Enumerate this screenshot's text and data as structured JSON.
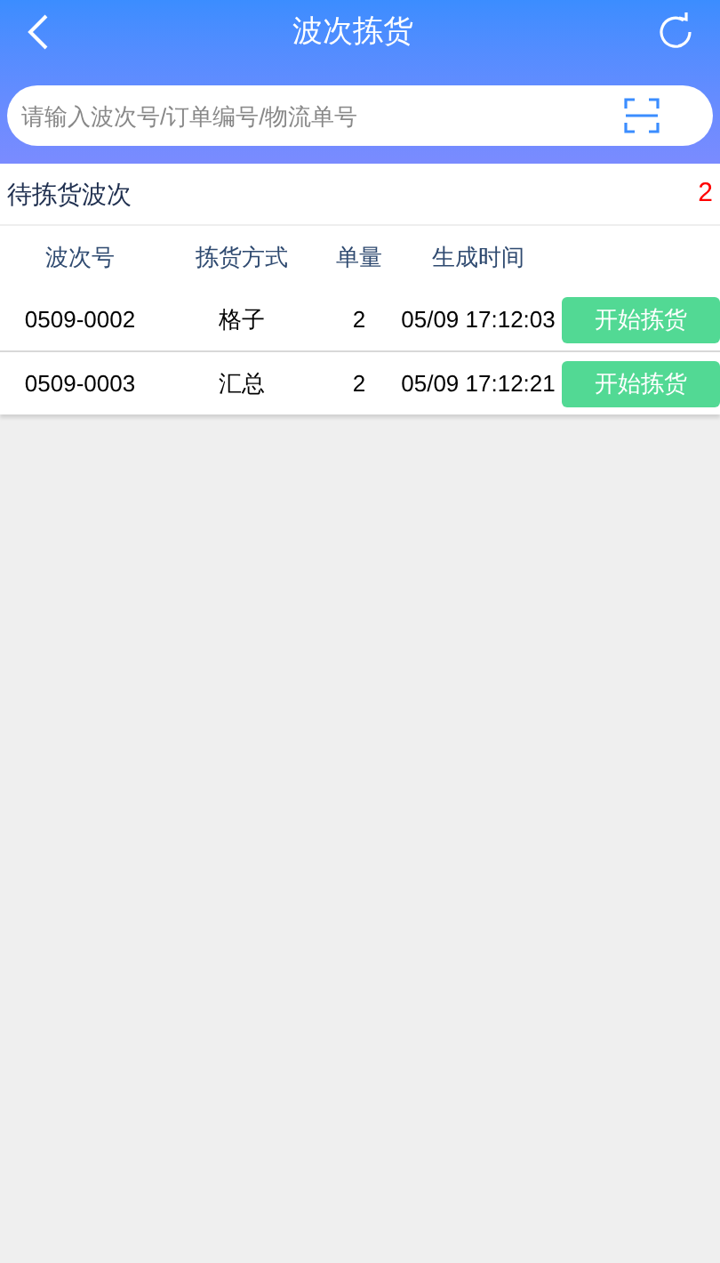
{
  "header": {
    "title": "波次拣货"
  },
  "search": {
    "placeholder": "请输入波次号/订单编号/物流单号"
  },
  "summary": {
    "label": "待拣货波次",
    "count": "2"
  },
  "table": {
    "columns": [
      "波次号",
      "拣货方式",
      "单量",
      "生成时间"
    ],
    "rows": [
      {
        "cells": [
          "0509-0002",
          "格子",
          "2",
          "05/09 17:12:03"
        ],
        "action": "开始拣货"
      },
      {
        "cells": [
          "0509-0003",
          "汇总",
          "2",
          "05/09 17:12:21"
        ],
        "action": "开始拣货"
      }
    ]
  }
}
